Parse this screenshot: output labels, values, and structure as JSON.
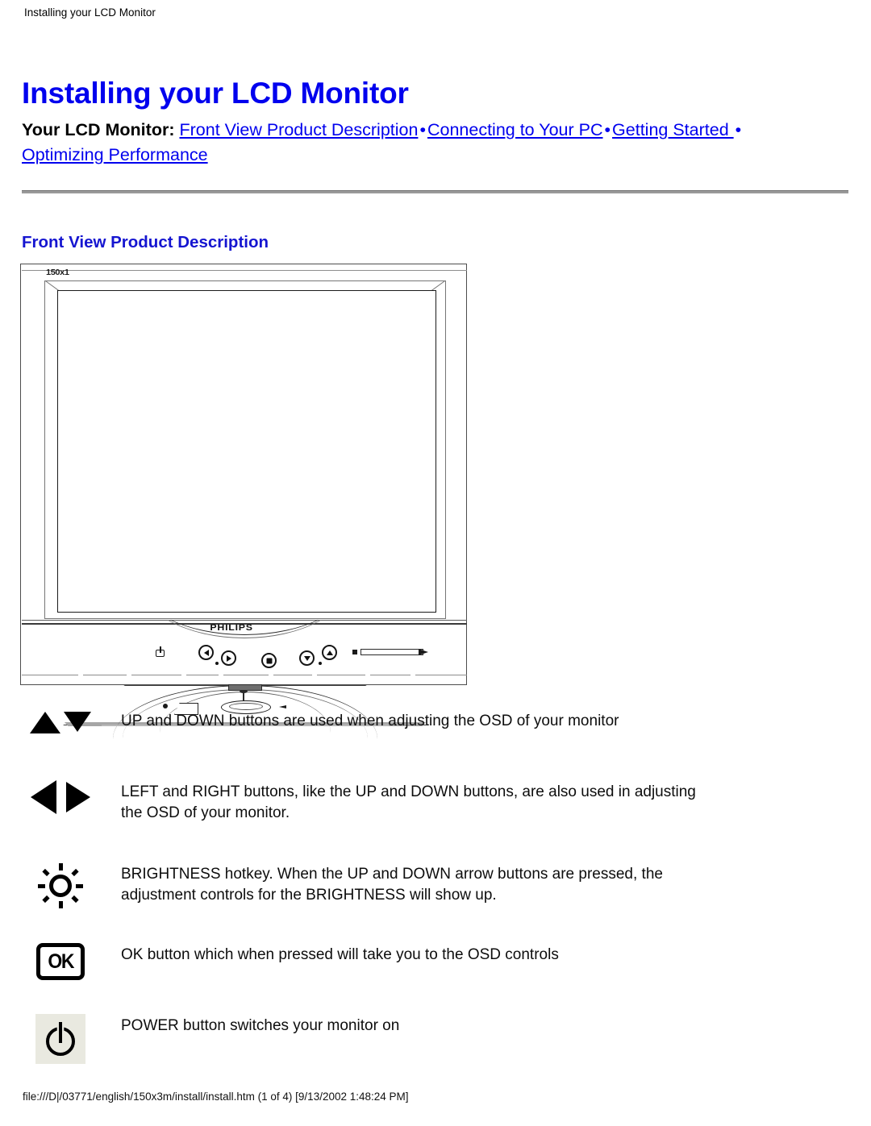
{
  "document": {
    "running_head": "Installing your LCD Monitor",
    "title": "Installing your LCD Monitor",
    "footer": "file:///D|/03771/english/150x3m/install/install.htm (1 of 4) [9/13/2002 1:48:24 PM]"
  },
  "colors": {
    "link": "#0000ee",
    "heading": "#1515d0",
    "title": "#0000ee",
    "rule": "#9a9a9a",
    "text": "#000000",
    "power_icon_background": "#e9e9e0"
  },
  "nav": {
    "lead_label": "Your LCD Monitor",
    "separator": ":",
    "bullet": "•",
    "links": [
      {
        "label": "Front View Product Description"
      },
      {
        "label": "Connecting to Your PC"
      },
      {
        "label": "Getting Started "
      },
      {
        "label": "Optimizing Performance"
      }
    ]
  },
  "section": {
    "heading": "Front View Product Description"
  },
  "monitor": {
    "model_label": "150x1",
    "brand_logo": "PHILIPS",
    "controls": [
      {
        "name": "power",
        "symbol": "power"
      },
      {
        "name": "left",
        "symbol": "◀"
      },
      {
        "name": "right",
        "symbol": "▶"
      },
      {
        "name": "ok",
        "symbol": "■"
      },
      {
        "name": "down",
        "symbol": "▼"
      },
      {
        "name": "up",
        "symbol": "▲"
      }
    ]
  },
  "legend": {
    "rows": [
      {
        "icon": "up-down-arrows-icon",
        "text": "UP and DOWN buttons are used when adjusting the OSD of your monitor"
      },
      {
        "icon": "left-right-arrows-icon",
        "text": "LEFT and RIGHT buttons, like the UP and DOWN buttons, are also used in adjusting the OSD of your monitor."
      },
      {
        "icon": "brightness-sun-icon",
        "text": "BRIGHTNESS hotkey. When the UP and DOWN arrow buttons are pressed, the adjustment controls for the BRIGHTNESS will show up."
      },
      {
        "icon": "ok-button-icon",
        "label": "OK",
        "text": "OK button which when pressed will take you to the OSD controls"
      },
      {
        "icon": "power-button-icon",
        "text": "POWER button switches your monitor on"
      }
    ]
  }
}
